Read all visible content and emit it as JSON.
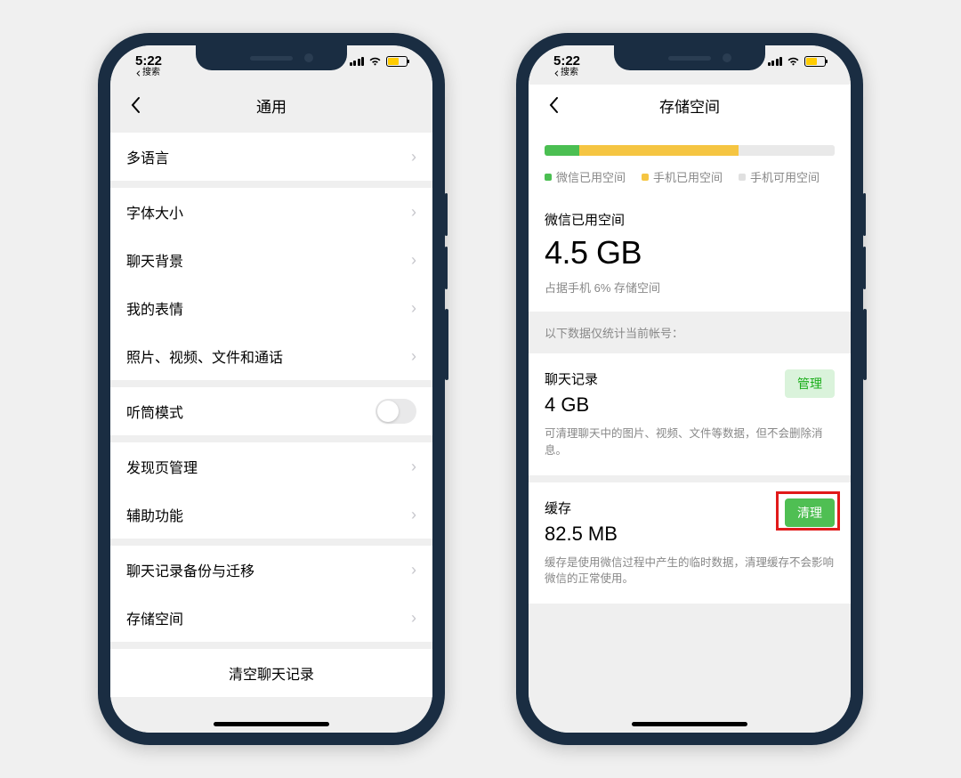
{
  "status": {
    "time": "5:22",
    "back_hint": "搜索"
  },
  "left_phone": {
    "title": "通用",
    "rows": {
      "language": "多语言",
      "font_size": "字体大小",
      "chat_bg": "聊天背景",
      "stickers": "我的表情",
      "media": "照片、视频、文件和通话",
      "earpiece": "听筒模式",
      "discover": "发现页管理",
      "accessibility": "辅助功能",
      "chat_backup": "聊天记录备份与迁移",
      "storage": "存储空间",
      "clear": "清空聊天记录"
    }
  },
  "right_phone": {
    "title": "存储空间",
    "bar": {
      "wechat_pct": 12,
      "phone_used_pct": 55,
      "free_pct": 33
    },
    "legend": {
      "wechat": "微信已用空间",
      "phone": "手机已用空间",
      "free": "手机可用空间"
    },
    "main_stat": {
      "label": "微信已用空间",
      "value": "4.5 GB",
      "sub": "占据手机 6% 存储空间"
    },
    "section_note": "以下数据仅统计当前帐号：",
    "chat_card": {
      "title": "聊天记录",
      "value": "4 GB",
      "desc": "可清理聊天中的图片、视频、文件等数据，但不会删除消息。",
      "button": "管理"
    },
    "cache_card": {
      "title": "缓存",
      "value": "82.5 MB",
      "desc": "缓存是使用微信过程中产生的临时数据，清理缓存不会影响微信的正常使用。",
      "button": "清理"
    }
  }
}
